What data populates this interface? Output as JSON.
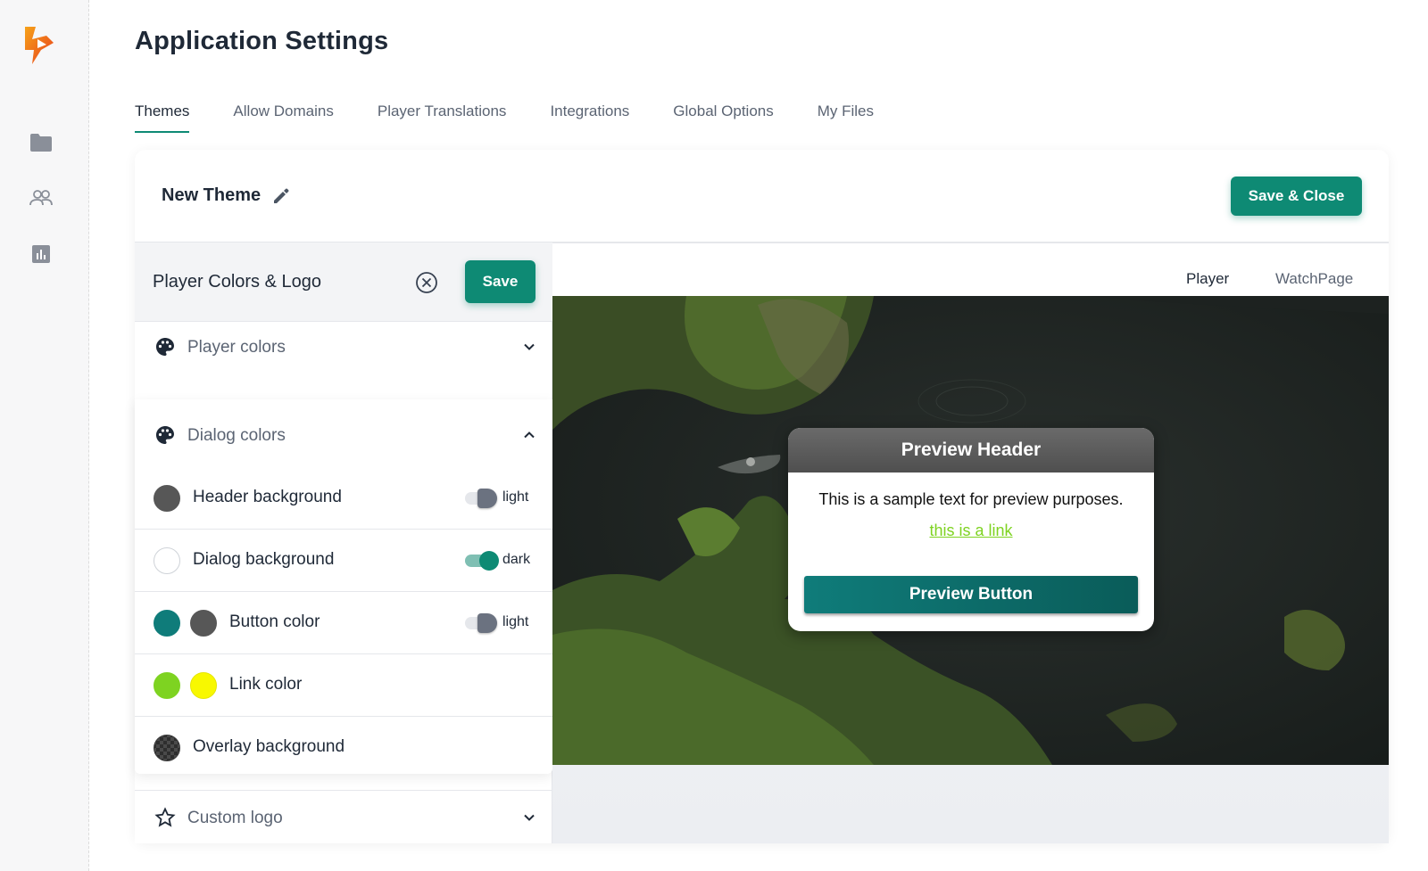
{
  "app": {
    "title": "Application Settings"
  },
  "sidebar": {
    "items": [
      {
        "icon": "folder-icon"
      },
      {
        "icon": "users-icon"
      },
      {
        "icon": "chart-icon"
      }
    ]
  },
  "tabs": [
    {
      "label": "Themes",
      "active": true
    },
    {
      "label": "Allow Domains"
    },
    {
      "label": "Player Translations"
    },
    {
      "label": "Integrations"
    },
    {
      "label": "Global Options"
    },
    {
      "label": "My Files"
    }
  ],
  "theme": {
    "name": "New Theme",
    "save_close_label": "Save & Close"
  },
  "panel": {
    "title": "Player Colors & Logo",
    "save_label": "Save",
    "sections": {
      "player_colors": "Player colors",
      "dialog_colors": "Dialog colors",
      "custom_logo": "Custom logo"
    },
    "dialog_rows": [
      {
        "label": "Header background",
        "swatches": [
          "#575757"
        ],
        "toggle": "light",
        "toggle_on": false
      },
      {
        "label": "Dialog background",
        "swatches": [
          "#ffffff"
        ],
        "toggle": "dark",
        "toggle_on": true
      },
      {
        "label": "Button color",
        "swatches": [
          "#0f7c7a",
          "#575757"
        ],
        "toggle": "light",
        "toggle_on": false
      },
      {
        "label": "Link color",
        "swatches": [
          "#7ed321",
          "#f8f800"
        ]
      },
      {
        "label": "Overlay background",
        "swatches": [
          "#3a3a3a"
        ]
      }
    ]
  },
  "preview": {
    "tabs": [
      {
        "label": "Player",
        "active": true
      },
      {
        "label": "WatchPage"
      }
    ],
    "dialog": {
      "header": "Preview Header",
      "text": "This is a sample text for preview purposes.",
      "link": "this is a link",
      "button": "Preview Button"
    }
  },
  "colors": {
    "accent": "#0e8a74"
  }
}
